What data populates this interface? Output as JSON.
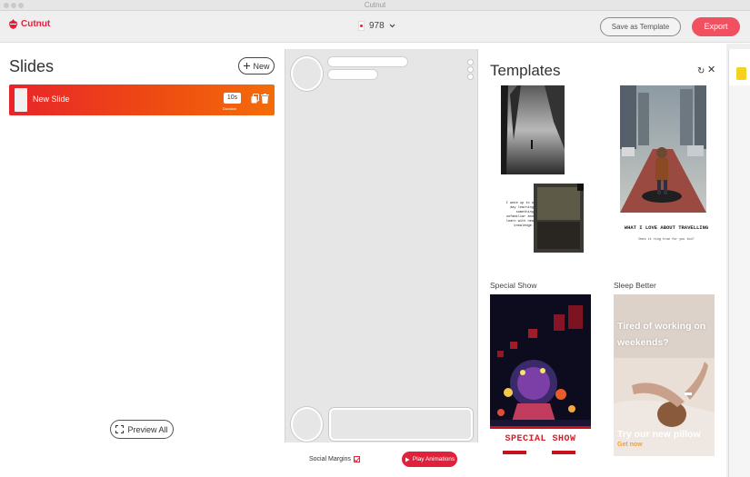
{
  "window": {
    "title": "Cutnut"
  },
  "header": {
    "app_name": "Cutnut",
    "project_name": "978",
    "save_template_label": "Save as Template",
    "export_label": "Export",
    "accent": "#e0213b"
  },
  "slides": {
    "title": "Slides",
    "new_label": "New",
    "items": [
      {
        "name": "New Slide",
        "duration": "10s",
        "duration_caption": "Duration"
      }
    ],
    "preview_label": "Preview All"
  },
  "canvas": {
    "social_margins_label": "Social Margins",
    "social_margins_checked": true,
    "play_label": "Play Animations"
  },
  "templates": {
    "title": "Templates",
    "items": [
      {
        "name": "",
        "text": "I woke up to a day learning something unfamiliar and learn with new knowledge."
      },
      {
        "name": "",
        "heading": "WHAT I LOVE ABOUT TRAVELLING",
        "sub": "Does it ring true for you too?"
      },
      {
        "name": "Special Show",
        "heading": "SPECIAL SHOW"
      },
      {
        "name": "Sleep Better",
        "text": "Tired of working on weekends?",
        "footer": "Try our new pillow",
        "footer_sub": "Get now"
      }
    ]
  },
  "colors": {
    "accent": "#e0213b",
    "export": "#f0505f",
    "rail_icon": "#f4d21f"
  }
}
